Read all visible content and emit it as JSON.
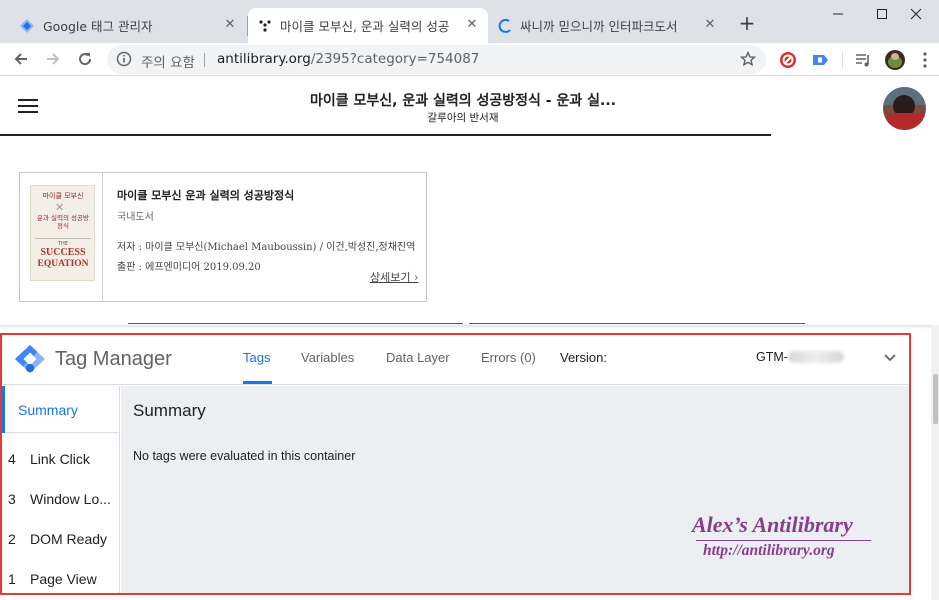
{
  "browser": {
    "tabs": [
      {
        "title": "Google 태그 관리자",
        "close": "✕"
      },
      {
        "title": "마이클 모부신, 운과 실력의 성공",
        "close": "✕"
      },
      {
        "title": "싸니까 믿으니까 인터파크도서",
        "close": "✕"
      }
    ],
    "new_tab": "+",
    "omnibox": {
      "warning": "주의 요함",
      "url_host": "antilibrary.org",
      "url_rest": "/2395?category=754087"
    }
  },
  "page": {
    "title": "마이클 모부신, 운과 실력의 성공방정식 - 운과 실...",
    "subtitle": "갈루아의 반서재",
    "book": {
      "title": "마이클 모부신 운과 실력의 성공방정식",
      "category": "국내도서",
      "author": "저자 : 마이클 모부신(Michael Mauboussin) / 이건,박성진,정채진역",
      "publisher": "출판 : 에프엔미디어 2019.09.20",
      "more": "상세보기 ›",
      "cover": {
        "author": "마이클 모부신",
        "title": "운과 실력의 성공방정식",
        "en1": "THE",
        "en2": "SUCCESS",
        "en3": "EQUATION"
      }
    }
  },
  "tag_manager": {
    "brand": "Tag Manager",
    "tabs": [
      {
        "label": "Tags",
        "active": true
      },
      {
        "label": "Variables"
      },
      {
        "label": "Data Layer"
      },
      {
        "label": "Errors (0)"
      }
    ],
    "version_label": "Version:",
    "gtm_prefix": "GTM-",
    "sidebar": {
      "summary": "Summary",
      "events": [
        {
          "num": "4",
          "label": "Link Click"
        },
        {
          "num": "3",
          "label": "Window Lo..."
        },
        {
          "num": "2",
          "label": "DOM Ready"
        },
        {
          "num": "1",
          "label": "Page View"
        }
      ]
    },
    "main": {
      "title": "Summary",
      "message": "No tags were evaluated in this container"
    }
  },
  "watermark": {
    "title": "Alex’s Antilibrary",
    "url": "http://antilibrary.org"
  },
  "colors": {
    "accent_blue": "#1a73e8",
    "highlight_border": "#e53935",
    "watermark": "#8a3d8f"
  }
}
